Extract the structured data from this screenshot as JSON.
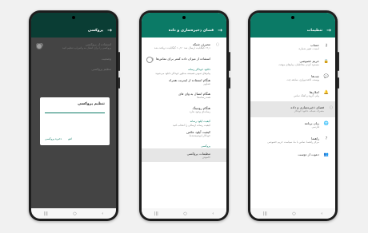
{
  "colors": {
    "accent": "#0b7a66"
  },
  "phone1": {
    "title": "پروکسی",
    "rows": [
      {
        "t1": "استفاده از پروکسی",
        "t2": "پروکسی را برای اتصال به واتس‌اپ تنظیم کنید"
      },
      {
        "t1": "وضعیت",
        "t2": ""
      },
      {
        "t1": "تنظیم پروکسی",
        "t2": ""
      }
    ],
    "dialog": {
      "title": "تنظیم پروکسی",
      "cancel": "لغو",
      "save": "ذخیره پروکسی"
    }
  },
  "phone2": {
    "title": "فضای ذخیره‌سازی و داده",
    "network_title": "مصرف شبکه",
    "network_sub": "۱۲٫۱ گیگابایت ارسال شد · ۱۰٫۷ گیگابایت دریافت شد",
    "less_data_title": "استفاده از میزان داده کمتر برای تماس‌ها",
    "auto_download_section": "دانلود خودکار رسانه",
    "auto_download_note": "پیام‌های صوتی همیشه به‌طور خودکار دانلود می‌شوند",
    "mobile_title": "هنگام استفاده از اینترنت همراه",
    "mobile_sub": "تصاویر",
    "wifi_title": "هنگام اتصال به وای فای",
    "wifi_sub": "همه رسانه‌ها",
    "roaming_title": "هنگام رومینگ",
    "roaming_sub": "رسانه‌ای وجود ندارد",
    "quality_section": "کیفیت آپلود رسانه",
    "quality_note": "کیفیت رسانه ارسالی را انتخاب کنید",
    "photo_quality_title": "کیفیت آپلود عکس",
    "photo_quality_sub": "خودکار (توصیه‌شده)",
    "proxy_section": "پروکسی",
    "proxy_title": "تنظیمات پروکسی",
    "proxy_sub": "خاموش"
  },
  "phone3": {
    "title": "تنظیمات",
    "items": [
      {
        "icon": "key-icon",
        "glyph": "⚷",
        "t1": "حساب",
        "t2": "امنیت، تغییر شماره"
      },
      {
        "icon": "lock-icon",
        "glyph": "🔒",
        "t1": "حریم خصوصی",
        "t2": "مسدود کردن مخاطبان، پیام‌های موقت"
      },
      {
        "icon": "chat-icon",
        "glyph": "💬",
        "t1": "چت‌ها",
        "t2": "پوسته، کاغذدیواری، سابقه چت"
      },
      {
        "icon": "bell-icon",
        "glyph": "🔔",
        "t1": "اعلان‌ها",
        "t2": "پیام، گروه و آهنگ تماس"
      },
      {
        "icon": "storage-icon",
        "glyph": "◌",
        "t1": "فضای ذخیره‌سازی و داده",
        "t2": "مصرف شبکه، دانلود خودکار"
      },
      {
        "icon": "globe-icon",
        "glyph": "🌐",
        "t1": "زبان برنامه",
        "t2": "فارسی"
      },
      {
        "icon": "help-icon",
        "glyph": "?",
        "t1": "راهنما",
        "t2": "مرکز راهنما، تماس با ما، سیاست حریم خصوصی"
      },
      {
        "icon": "people-icon",
        "glyph": "👥",
        "t1": "دعوت از دوست",
        "t2": ""
      }
    ]
  }
}
